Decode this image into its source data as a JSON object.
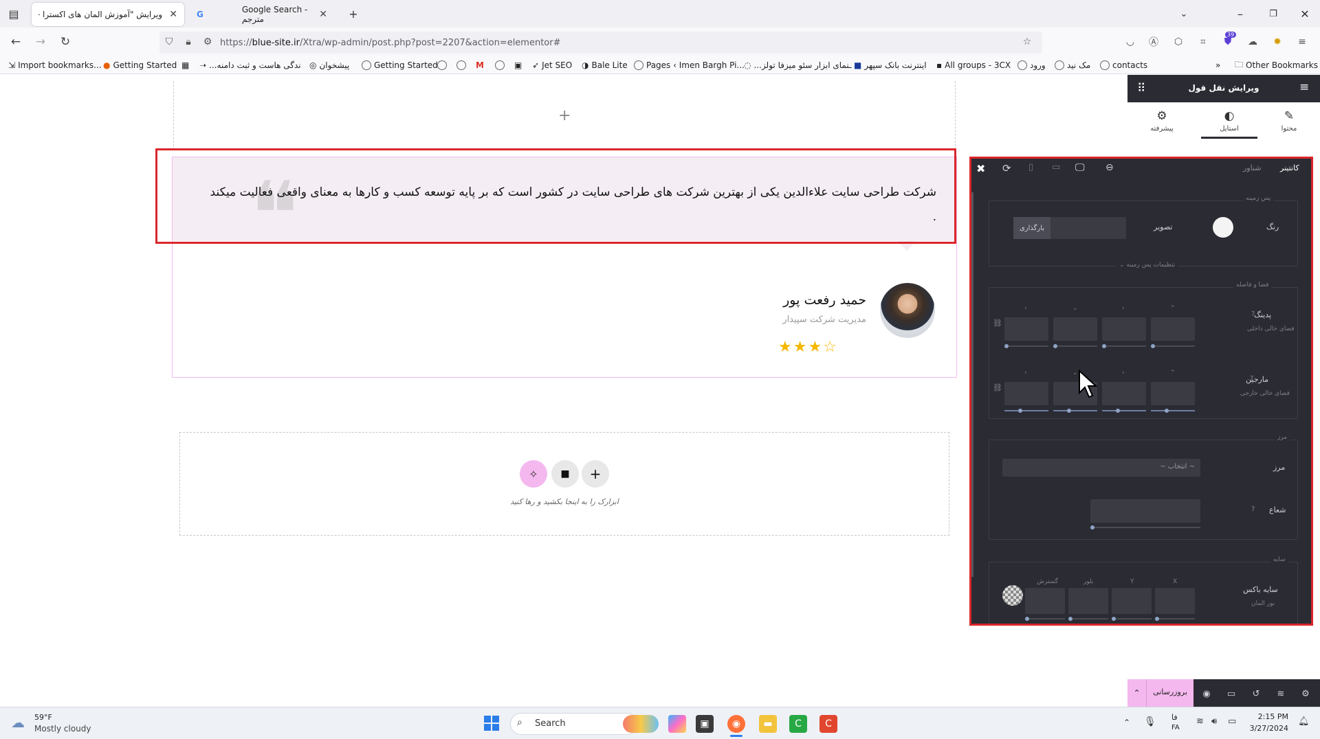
{
  "browser": {
    "tabs": [
      {
        "label": "ویرایش \"آموزش المان های اکسترا -"
      },
      {
        "label": "Google Search - مترجم"
      }
    ],
    "url_prefix": "https://",
    "url_domain": "blue-site.ir",
    "url_path": "/Xtra/wp-admin/post.php?post=2207&action=elementor#",
    "extension_badge": "39",
    "bookmarks": [
      "Import bookmarks...",
      "Getting Started",
      "...ندگی هاست و ثبت دامنه",
      "پیشخوان",
      "Getting Started",
      "Jet SEO",
      "Bale Lite",
      "Pages ‹ Imen Bargh Pi...",
      "...ـنمای ابزار سئو میزفا تولز",
      "اینترنت بانک سپهر",
      "All groups - 3CX",
      "ورود",
      "مک نید",
      "contacts"
    ],
    "other_bookmarks": "Other Bookmarks"
  },
  "canvas": {
    "add_plus": "+",
    "testimonial_text": "شرکت طراحی سایت علاءالدین یکی از بهترین شرکت های طراحی سایت در کشور است که بر پایه توسعه کسب و کارها به معنای واقعی فعالیت میکند .",
    "person_name": "حمید رفعت پور",
    "person_title": "مدیریت شرکت سپیدار",
    "rating": 3,
    "rating_max": 4,
    "drop_hint": "ابزارک را به اینجا بکشید و رها کنید"
  },
  "panel": {
    "title": "ویرایش نقل قول",
    "tabs": [
      "محتوا",
      "استایل",
      "پیشرفته"
    ],
    "float_tabs": [
      "کانتینر",
      "شناور"
    ],
    "background": {
      "section": "پس زمینه",
      "color_label": "رنگ",
      "image_label": "تصویر",
      "upload": "بارگذاری",
      "more": "تنظیمات پس زمینه"
    },
    "spacing": {
      "section": "فضا و فاصله",
      "padding_label": "پدینگ",
      "padding_sub": "فضای خالی داخلی",
      "margin_label": "مارجین",
      "margin_sub": "فضای خالی خارجی"
    },
    "border": {
      "section": "مرز",
      "border_label": "مرز",
      "select": "~ انتخاب ~",
      "radius_label": "شعاع"
    },
    "shadow": {
      "section": "سایه",
      "label": "سایه باکس",
      "sub": "نور المان",
      "cols": [
        "X",
        "Y",
        "بلور",
        "گسترش"
      ]
    },
    "update": "بروزرسانی"
  },
  "taskbar": {
    "weather_temp": "59°F",
    "weather_desc": "Mostly cloudy",
    "search": "Search",
    "lang1": "فا",
    "lang2": "FA",
    "time": "2:15 PM",
    "date": "3/27/2024"
  },
  "colors": {
    "accent_pink": "#f4b8ef",
    "highlight_red": "#d9262c",
    "panel_dark": "#2b2c33",
    "star": "#f5b800"
  }
}
